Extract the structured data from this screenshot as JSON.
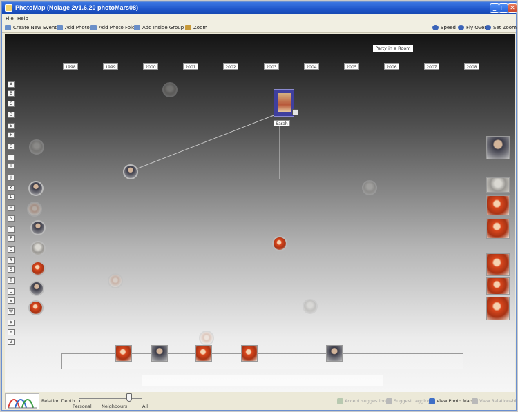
{
  "window": {
    "title": "PhotoMap (Nolage 2v1.6.20 photoMars08)",
    "minimize": "_",
    "maximize": "□",
    "close": "✕"
  },
  "menu": [
    "File",
    "Help"
  ],
  "toolbar": {
    "left": [
      {
        "label": "Create New Event",
        "icon": "create-event-icon",
        "color": "#6a8fc8"
      },
      {
        "label": "Add Photo",
        "icon": "add-photo-icon",
        "color": "#6a8fc8"
      },
      {
        "label": "Add Photo Folder",
        "icon": "add-folder-icon",
        "color": "#6a8fc8"
      },
      {
        "label": "Add Inside Group",
        "icon": "add-group-icon",
        "color": "#6a8fc8"
      },
      {
        "label": "Zoom",
        "icon": "zoom-icon",
        "color": "#c79a3a"
      }
    ],
    "right": [
      {
        "label": "Speed",
        "icon": "speed-icon",
        "color": "#3a63b8"
      },
      {
        "label": "Fly Over",
        "icon": "fly-over-icon",
        "color": "#3a63b8"
      },
      {
        "label": "Set Zoom",
        "icon": "set-zoom-icon",
        "color": "#3a63b8"
      }
    ]
  },
  "timeline": {
    "years": [
      "1998",
      "1999",
      "2000",
      "2001",
      "2002",
      "2003",
      "2004",
      "2005",
      "2006",
      "2007",
      "2008"
    ],
    "event_label": "Party in a Room",
    "selected_label": "Sarah"
  },
  "letters": [
    "A",
    "B",
    "C",
    "D",
    "E",
    "F",
    "G",
    "H",
    "I",
    "J",
    "K",
    "L",
    "M",
    "N",
    "O",
    "P",
    "Q",
    "R",
    "S",
    "T",
    "U",
    "V",
    "W",
    "X",
    "Y",
    "Z"
  ],
  "bottom": {
    "relation_depth_label": "Relation Depth",
    "slider_ticks": [
      "Personal",
      "Neighbours",
      "All"
    ],
    "slider_level": "All",
    "actions": [
      {
        "label": "Accept suggestions",
        "icon": "accept-icon",
        "enabled": false
      },
      {
        "label": "Suggest tagging",
        "icon": "suggest-icon",
        "enabled": false
      },
      {
        "label": "View Photo Map",
        "icon": "photo-map-icon",
        "enabled": true
      },
      {
        "label": "View Relationships",
        "icon": "relationships-icon",
        "enabled": false
      }
    ]
  },
  "colors": {
    "titlebar": "#1e54c8",
    "selection": "#3f3f9e",
    "canvas_top": "#141414",
    "canvas_bottom": "#f6f6f6"
  }
}
